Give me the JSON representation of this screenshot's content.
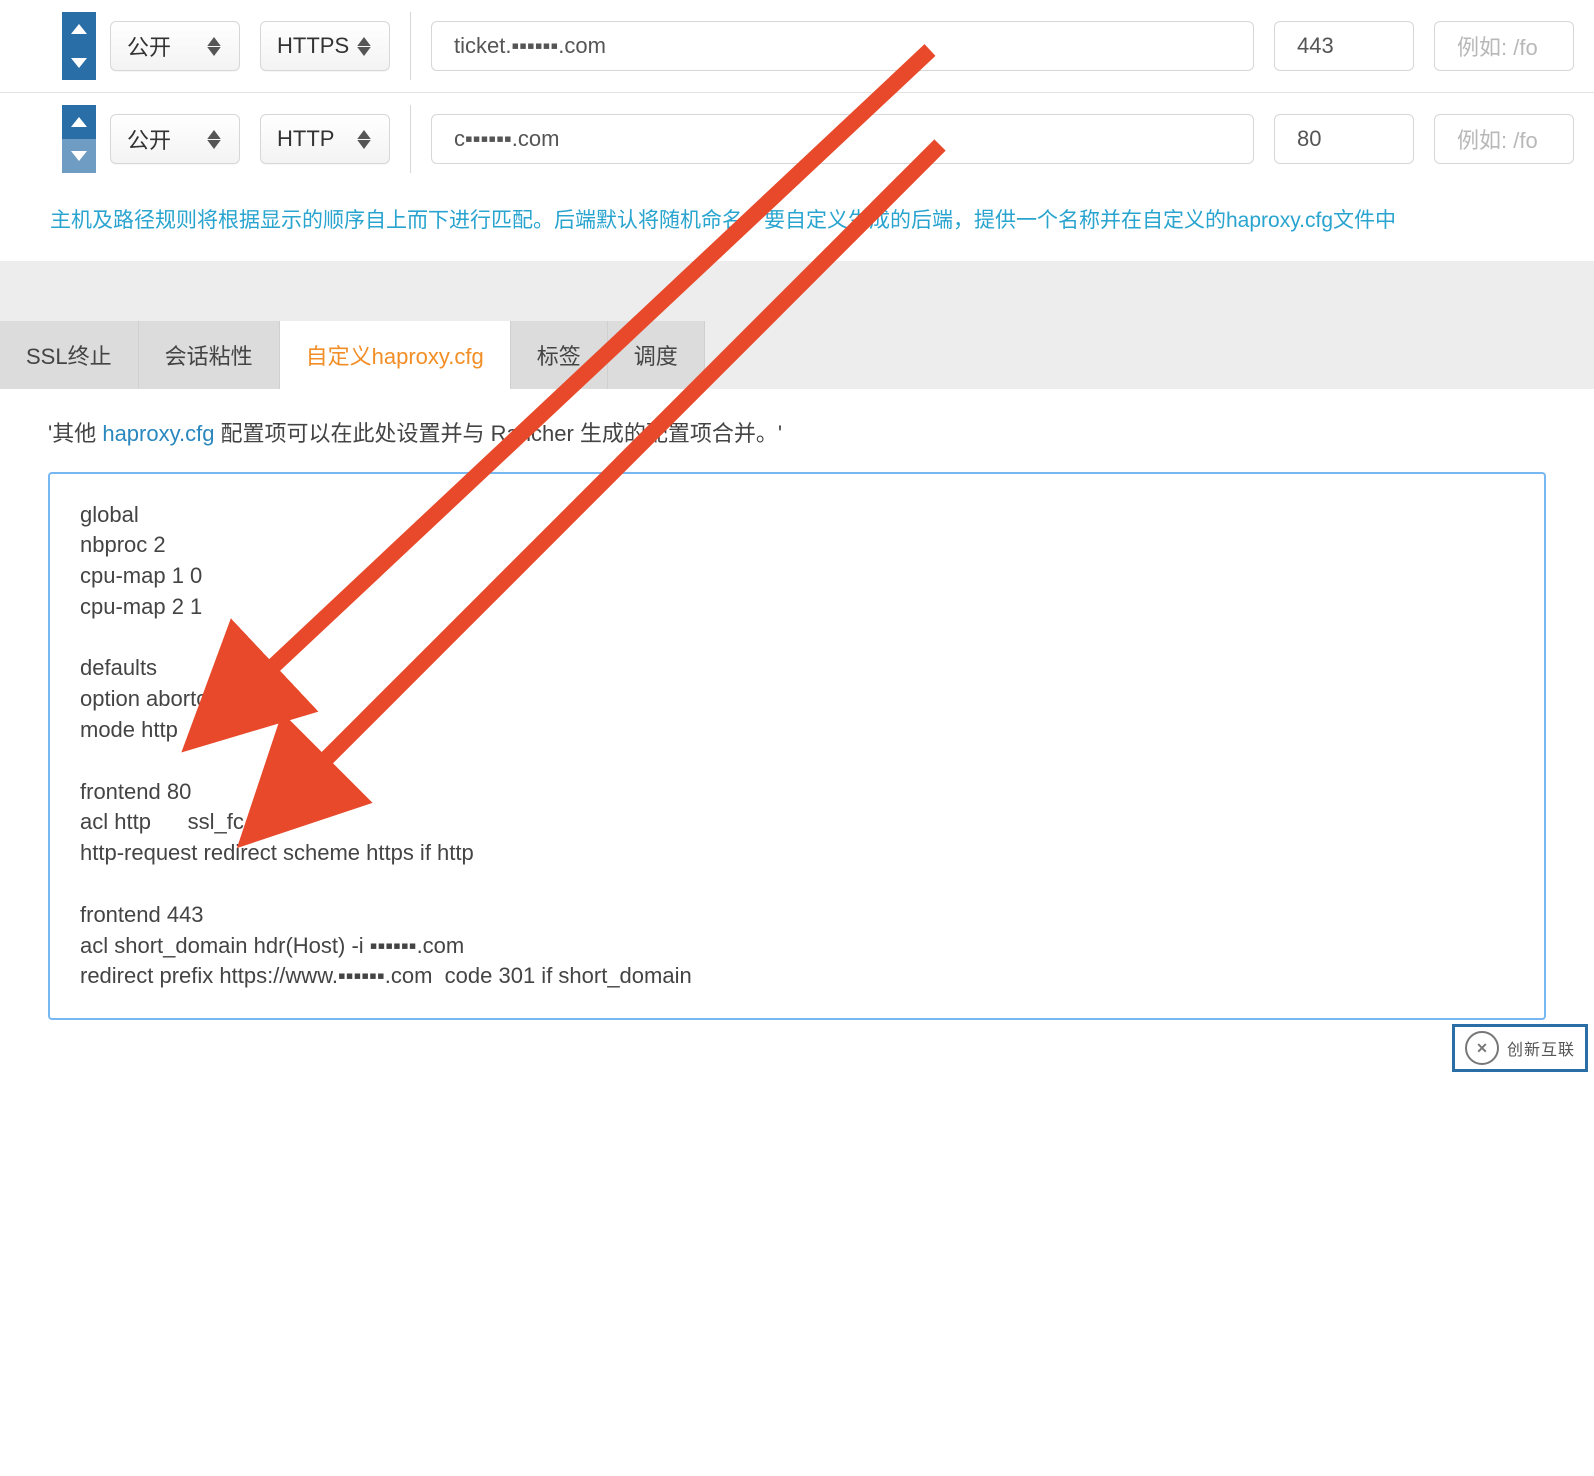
{
  "rules": [
    {
      "access": "公开",
      "protocol": "HTTPS",
      "host": "ticket.▪▪▪▪▪▪.com",
      "port": "443",
      "path_placeholder": "例如: /fo",
      "up_disabled": false,
      "down_disabled": false
    },
    {
      "access": "公开",
      "protocol": "HTTP",
      "host": "c▪▪▪▪▪▪.com",
      "port": "80",
      "path_placeholder": "例如: /fo",
      "up_disabled": false,
      "down_disabled": true
    }
  ],
  "help_text": "主机及路径规则将根据显示的顺序自上而下进行匹配。后端默认将随机命名。要自定义生成的后端，提供一个名称并在自定义的haproxy.cfg文件中",
  "tabs": {
    "ssl": "SSL终止",
    "sticky": "会话粘性",
    "custom": "自定义haproxy.cfg",
    "labels": "标签",
    "sched": "调度"
  },
  "hint": {
    "prefix": "'其他 ",
    "link": "haproxy.cfg",
    "suffix": " 配置项可以在此处设置并与 Rancher 生成的配置项合并。'"
  },
  "config_text": "global\nnbproc 2\ncpu-map 1 0\ncpu-map 2 1\n\ndefaults\noption abortonclose\nmode http\n\nfrontend 80\nacl http      ssl_fc,not\nhttp-request redirect scheme https if http\n\nfrontend 443\nacl short_domain hdr(Host) -i ▪▪▪▪▪▪.com\nredirect prefix https://www.▪▪▪▪▪▪.com  code 301 if short_domain",
  "watermark": "创新互联"
}
